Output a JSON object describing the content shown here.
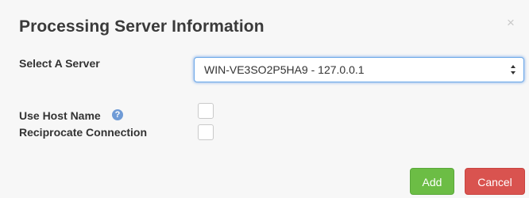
{
  "dialog": {
    "title": "Processing Server Information",
    "close_icon": "close-icon"
  },
  "form": {
    "server_label": "Select A Server",
    "server_value": "WIN-VE3SO2P5HA9 - 127.0.0.1",
    "use_host_name_label": "Use Host Name",
    "help_icon": "question-circle-icon",
    "help_glyph": "?",
    "reciprocate_label": "Reciprocate Connection",
    "use_host_name_checked": false,
    "reciprocate_checked": false
  },
  "buttons": {
    "add_label": "Add",
    "cancel_label": "Cancel"
  },
  "colors": {
    "add_button": "#6cbd45",
    "cancel_button": "#d9534f",
    "select_focus": "#6aa7e8",
    "help_icon": "#6f9bd6"
  }
}
